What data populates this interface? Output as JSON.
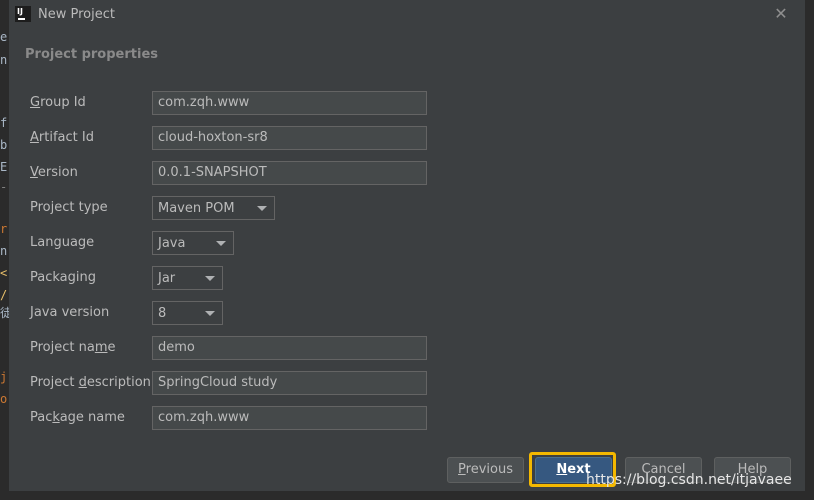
{
  "editor_strip": {
    "chars": [
      "e",
      "n",
      "f",
      "b",
      "E",
      "-",
      "r",
      "n",
      "<",
      "/",
      "徒",
      "j",
      "o"
    ],
    "colors": [
      "#a9b7c6",
      "#a9b7c6",
      "#a9b7c6",
      "#a9b7c6",
      "#a9b7c6",
      "#808080",
      "#cc7832",
      "#a9b7c6",
      "#e8bf6a",
      "#e8bf6a",
      "#a9b7c6",
      "#cc7832",
      "#cc7832"
    ]
  },
  "window": {
    "title": "New Project",
    "icon": "intellij-idea-icon",
    "close_glyph": "✕"
  },
  "section": {
    "title": "Project properties"
  },
  "form": {
    "group_id": {
      "label_m": "G",
      "label_rest": "roup Id",
      "value": "com.zqh.www"
    },
    "artifact_id": {
      "label_m": "A",
      "label_rest": "rtifact Id",
      "value": "cloud-hoxton-sr8"
    },
    "version": {
      "label_m": "V",
      "label_rest": "ersion",
      "value": "0.0.1-SNAPSHOT"
    },
    "project_type": {
      "label": "Project type",
      "value": "Maven POM"
    },
    "language": {
      "label": "Language",
      "value": "Java"
    },
    "packaging": {
      "label": "Packaging",
      "value": "Jar"
    },
    "java_version": {
      "label": "Java version",
      "value": "8"
    },
    "project_name": {
      "label_pre": "Project na",
      "label_m": "m",
      "label_post": "e",
      "value": "demo"
    },
    "project_description": {
      "label_pre": "Project ",
      "label_m": "d",
      "label_post": "escription",
      "value": "SpringCloud study"
    },
    "package_name": {
      "label_pre": "Pac",
      "label_m": "k",
      "label_post": "age name",
      "value": "com.zqh.www"
    }
  },
  "buttons": {
    "previous": {
      "m": "P",
      "rest": "revious"
    },
    "next": {
      "m": "N",
      "rest": "ext"
    },
    "cancel": {
      "label": "Cancel"
    },
    "help": {
      "label": "Help"
    }
  },
  "watermark": "https://blog.csdn.net/itjavaee",
  "colors": {
    "dialog_bg": "#3c3f41",
    "field_bg": "#45494a",
    "accent_button": "#365880",
    "highlight": "#f4b800"
  }
}
